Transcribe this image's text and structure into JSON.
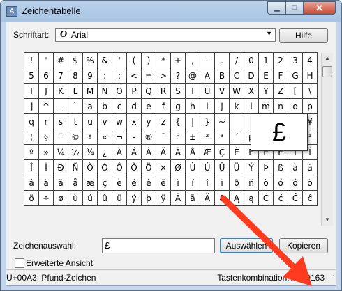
{
  "window": {
    "title": "Zeichentabelle",
    "app_icon": "charmap-icon"
  },
  "font": {
    "label": "Schriftart:",
    "value": "Arial",
    "type_icon": "opentype-font-icon"
  },
  "buttons": {
    "help": "Hilfe",
    "select": "Auswählen",
    "copy": "Kopieren"
  },
  "characters": [
    "!",
    "\"",
    "#",
    "$",
    "%",
    "&",
    "'",
    "(",
    ")",
    "*",
    "+",
    ",",
    "-",
    ".",
    "/",
    "0",
    "1",
    "2",
    "3",
    "4",
    "5",
    "6",
    "7",
    "8",
    "9",
    ":",
    ";",
    "<",
    "=",
    ">",
    "?",
    "@",
    "A",
    "B",
    "C",
    "D",
    "E",
    "F",
    "G",
    "H",
    "I",
    "J",
    "K",
    "L",
    "M",
    "N",
    "O",
    "P",
    "Q",
    "R",
    "S",
    "T",
    "U",
    "V",
    "W",
    "X",
    "Y",
    "Z",
    "[",
    "\\",
    "]",
    "^",
    "_",
    "`",
    "a",
    "b",
    "c",
    "d",
    "e",
    "f",
    "g",
    "h",
    "i",
    "j",
    "k",
    "l",
    "m",
    "n",
    "o",
    "p",
    "q",
    "r",
    "s",
    "t",
    "u",
    "v",
    "w",
    "x",
    "y",
    "z",
    "{",
    "|",
    "}",
    "~",
    " ",
    "¡",
    "¢",
    "£",
    "¤",
    "¥",
    "¦",
    "§",
    "¨",
    "©",
    "ª",
    "«",
    "¬",
    "-",
    "®",
    "¯",
    "°",
    "±",
    "²",
    "³",
    "´",
    "µ",
    "¶",
    "·",
    "¸",
    "¹",
    "º",
    "»",
    "¼",
    "½",
    "¾",
    "¿",
    "À",
    "Á",
    "Â",
    "Ã",
    "Ä",
    "Å",
    "Æ",
    "Ç",
    "È",
    "É",
    "Ê",
    "Ë",
    "Ì",
    "Í",
    "Î",
    "Ï",
    "Ð",
    "Ñ",
    "Ò",
    "Ó",
    "Ô",
    "Õ",
    "Ö",
    "×",
    "Ø",
    "Ù",
    "Ú",
    "Û",
    "Ü",
    "Ý",
    "Þ",
    "ß",
    "à",
    "á",
    "â",
    "ã",
    "ä",
    "å",
    "æ",
    "ç",
    "è",
    "é",
    "ê",
    "ë",
    "ì",
    "í",
    "î",
    "ï",
    "ð",
    "ñ",
    "ò",
    "ó",
    "ô",
    "õ",
    "ö",
    "÷",
    "ø",
    "ù",
    "ú",
    "û",
    "ü",
    "ý",
    "þ",
    "ÿ",
    "Ā",
    "ā",
    "Ă",
    "ă",
    "Ą",
    "ą",
    "Ć",
    "ć",
    "Ĉ",
    "ĉ"
  ],
  "zoomed_char": "£",
  "selection": {
    "label": "Zeichenauswahl:",
    "value": "£"
  },
  "advanced": {
    "label": "Erweiterte Ansicht",
    "checked": false
  },
  "status": {
    "char_info": "U+00A3: Pfund-Zeichen",
    "key_combo": "Tastenkombination: Alt+0163"
  },
  "annotation": {
    "arrow_color": "#ff3b1f"
  }
}
